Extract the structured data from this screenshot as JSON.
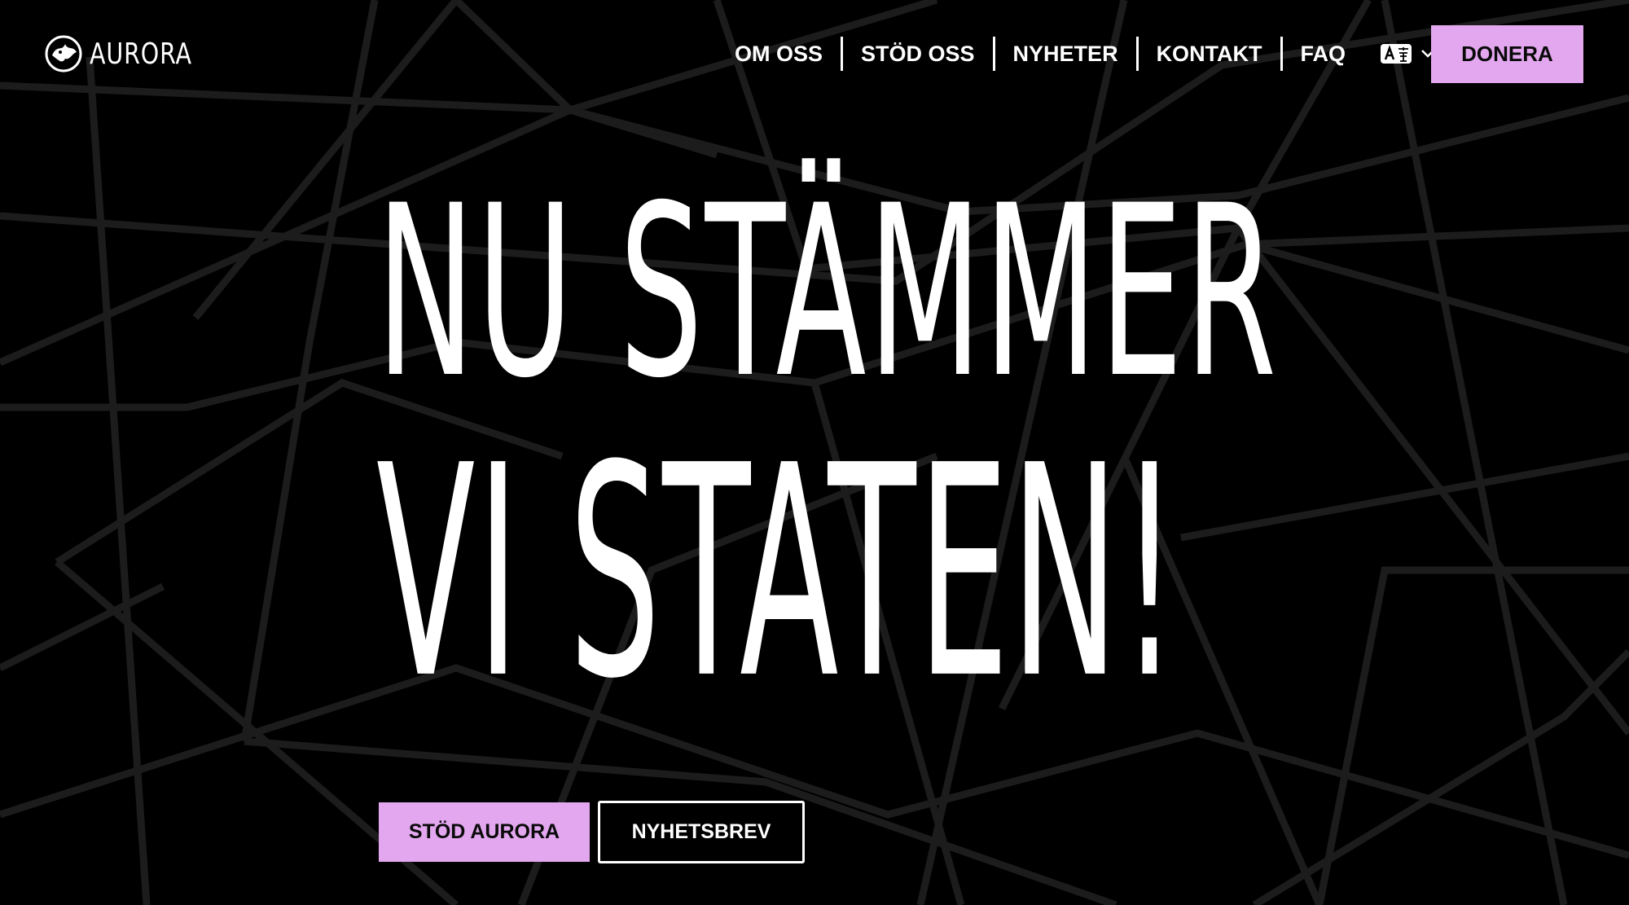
{
  "brand": {
    "logo_text": "AURORA",
    "accent_color": "#e2a7ee",
    "background_color": "#000000",
    "line_color": "#1c1c1c"
  },
  "nav": {
    "items": [
      {
        "label": "OM OSS"
      },
      {
        "label": "STÖD OSS"
      },
      {
        "label": "NYHETER"
      },
      {
        "label": "KONTAKT"
      },
      {
        "label": "FAQ"
      }
    ],
    "language_icon": "translate-icon",
    "language_chevron": "chevron-down-icon",
    "donate_label": "DONERA"
  },
  "hero": {
    "line1": "NU STÄMMER",
    "line2": "VI STATEN!"
  },
  "cta": {
    "primary_label": "STÖD AURORA",
    "secondary_label": "NYHETSBREV"
  }
}
